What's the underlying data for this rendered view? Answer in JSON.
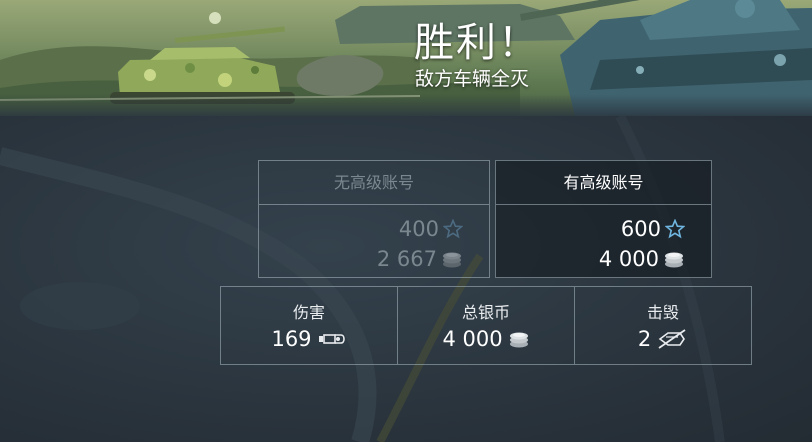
{
  "banner": {
    "title": "胜利！",
    "subtitle": "敌方车辆全灭"
  },
  "accounts": {
    "basic": {
      "header": "无高级账号",
      "experience": "400",
      "silver": "2 667"
    },
    "premium": {
      "header": "有高级账号",
      "experience": "600",
      "silver": "4 000"
    }
  },
  "stats": {
    "damage": {
      "label": "伤害",
      "value": "169"
    },
    "total_silver": {
      "label": "总银币",
      "value": "4 000"
    },
    "kills": {
      "label": "击毁",
      "value": "2"
    }
  },
  "icons": {
    "experience": "star-outline-icon",
    "silver": "coin-stack-icon",
    "damage": "shell-icon",
    "kills": "crossed-target-icon"
  },
  "colors": {
    "accent_blue": "#6fb6e0",
    "dim_text": "#7b878f",
    "panel_bg": "#2b3640"
  }
}
